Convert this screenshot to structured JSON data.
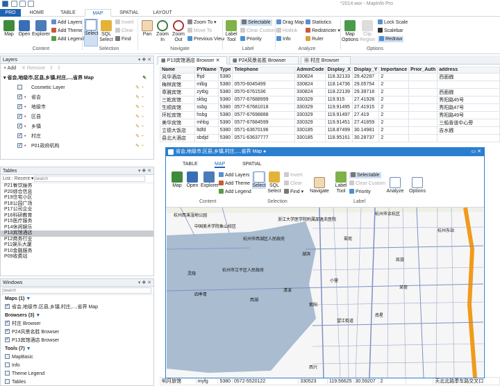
{
  "app": {
    "title": "*2014.wor - MapInfo Pro"
  },
  "ribbon_tabs": [
    "PRO",
    "HOME",
    "TABLE",
    "MAP",
    "SPATIAL",
    "LAYOUT"
  ],
  "ribbon": {
    "content": {
      "label": "Content",
      "map": "Map",
      "open": "Open",
      "explorer": "Explorer",
      "add_layers": "Add Layers",
      "add_theme": "Add Theme",
      "add_legend": "Add Legend"
    },
    "selection": {
      "label": "Selection",
      "select": "Select",
      "sql_select": "SQL\nSelect",
      "invert": "Invert",
      "clear": "Clear",
      "find": "Find"
    },
    "navigate": {
      "label": "Navigate",
      "pan": "Pan",
      "zoom_in": "Zoom\nIn",
      "zoom_out": "Zoom\nOut",
      "zoom_to": "Zoom To",
      "move_to": "Move To",
      "previous_view": "Previous View"
    },
    "label": {
      "label": "Label",
      "label_tool": "Label\nTool",
      "selectable": "Selectable",
      "clear_custom": "Clear Custom",
      "priority": "Priority"
    },
    "analyze": {
      "label": "Analyze",
      "drag_map": "Drag Map",
      "hotlink": "Hotlink",
      "info": "Info",
      "statistics": "Statistics",
      "redistricter": "Redistricter",
      "ruler": "Ruler"
    },
    "options": {
      "label": "Options",
      "map_options": "Map\nOptions",
      "clip_region": "Clip\nRegion",
      "lock_scale": "Lock Scale",
      "scalebar": "Scalebar",
      "redraw": "Redraw"
    }
  },
  "layers_panel": {
    "title": "Layers",
    "add": "Add",
    "remove": "Remove",
    "map_title": "省会,地级市,区县,乡镇,村庄,...,省界 Map",
    "layers": [
      {
        "name": "Cosmetic Layer",
        "checked": false
      },
      {
        "name": "省会",
        "checked": true
      },
      {
        "name": "地级市",
        "checked": true
      },
      {
        "name": "区县",
        "checked": true
      },
      {
        "name": "乡镇",
        "checked": true
      },
      {
        "name": "村庄",
        "checked": true
      },
      {
        "name": "P01政府机构",
        "checked": true
      }
    ]
  },
  "tables_panel": {
    "title": "Tables",
    "list_label": "List : Recent",
    "search_placeholder": "Search",
    "items": [
      "P21餐饮服务",
      "P20综合信息",
      "P19住宅小区",
      "P18公园广场",
      "P17公司企业",
      "P16科研教育",
      "P15医疗服务",
      "P14休闲娱乐",
      "P13宾馆酒店",
      "P12商务行业",
      "P11娱乐大厦",
      "P10金融服务",
      "P09收费站"
    ],
    "selected": "P13宾馆酒店"
  },
  "windows_panel": {
    "title": "Windows",
    "search_placeholder": "Search",
    "maps_header": "Maps (1)",
    "maps": [
      "省会,地级市,区县,乡镇,村庄,...,省界 Map"
    ],
    "browsers_header": "Browsers (3)",
    "browsers": [
      "村庄 Browser",
      "P24风景名胜 Browser",
      "P13宾馆酒店 Browser"
    ],
    "tools_header": "Tools (7)",
    "tools": [
      "MapBasic",
      "Info",
      "Theme Legend",
      "Tables"
    ]
  },
  "browser_tabs": [
    "P13宾馆酒店 Browser",
    "P24风景名胜 Browser",
    "村庄 Browser"
  ],
  "browser": {
    "columns": [
      "Name",
      "PYName",
      "Type",
      "Telephone",
      "AdminCode",
      "Display_X",
      "Display_Y",
      "Importance",
      "Prior_Auth",
      "address"
    ],
    "rows": [
      [
        "风华酒店",
        "fhjd",
        "5380",
        "",
        "330824",
        "118.32133",
        "29.42287",
        "2",
        "",
        "西面銭"
      ],
      [
        "梅林宾馆",
        "mlbg",
        "5380",
        "0570-6045499",
        "330824",
        "118.14736",
        "29.05754",
        "2",
        "",
        ""
      ],
      [
        "章雅宾馆",
        "zytbg",
        "5380",
        "0570-6761536",
        "330824",
        "118.22139",
        "29.39718",
        "2",
        "",
        "西面銭"
      ],
      [
        "三乾宾馆",
        "skbg",
        "5380",
        "0577-67688999",
        "330329",
        "119.915",
        "27.41928",
        "2",
        "",
        "秀阳路45号"
      ],
      [
        "生顺宾馆",
        "ssbg",
        "5380",
        "0577-67681018",
        "330329",
        "119.91495",
        "27.41915",
        "2",
        "",
        "秀阳路47号"
      ],
      [
        "环松宾馆",
        "hsbg",
        "5380",
        "0577-67698888",
        "330329",
        "119.91497",
        "27.419",
        "2",
        "",
        "秀阳路49号"
      ],
      [
        "美华宾馆",
        "mhbg",
        "5380",
        "0577-67684599",
        "330329",
        "119.91451",
        "27.41859",
        "2",
        "",
        "三船香道中心旁"
      ],
      [
        "立德大饭店",
        "ltdfd",
        "5380",
        "0571-63670196",
        "330185",
        "118.87499",
        "30.14981",
        "2",
        "",
        "吉水銭"
      ],
      [
        "县北大酒店",
        "sbdjd",
        "5380",
        "0571-63637777",
        "330185",
        "118.95161",
        "30.28737",
        "2",
        "",
        ""
      ]
    ],
    "last_row": [
      "明月旅馆",
      "myfg",
      "5380",
      "0572-5520122",
      "330523",
      "119.56625",
      "30.59207",
      "2",
      "",
      "天北北路季车路交叉口"
    ]
  },
  "map_window": {
    "title": "省会,地级市,区县,乡镇,村庄,...,省界 Map",
    "tabs": [
      "TABLE",
      "MAP",
      "SPATIAL"
    ],
    "ribbon": {
      "map": "Map",
      "open": "Open",
      "explorer": "Explorer",
      "add_layers": "Add Layers",
      "add_theme": "Add Theme",
      "add_legend": "Add Legend",
      "content": "Content",
      "select": "Select",
      "sql_select": "SQL\nSelect",
      "invert": "Invert",
      "clear": "Clear",
      "find": "Find",
      "selection": "Selection",
      "navigate": "Navigate",
      "label_tool": "Label\nTool",
      "selectable": "Selectable",
      "clear_custom": "Clear Custom",
      "priority": "Priority",
      "label": "Label",
      "analyze": "Analyze",
      "options": "Options"
    },
    "map_labels": [
      "中国美术学院象山校区",
      "杭州市西湖区人民政府",
      "浙江大学医学院附属邵逸夫医院",
      "望江街道",
      "灵隐",
      "西湖",
      "清波",
      "南星",
      "翠苑",
      "杭州东站",
      "杭州市江干区人民政府",
      "杭州西溪湿地公园",
      "杭州市余杭区",
      "湖滨",
      "小营",
      "紫阳",
      "凯旋",
      "采荷",
      "四季青",
      "西兴"
    ]
  },
  "colors": {
    "accent": "#1e63b4",
    "map_water": "#a9bcd0",
    "map_road_major": "#f29a1a",
    "map_road_minor": "#7d8fc4"
  }
}
